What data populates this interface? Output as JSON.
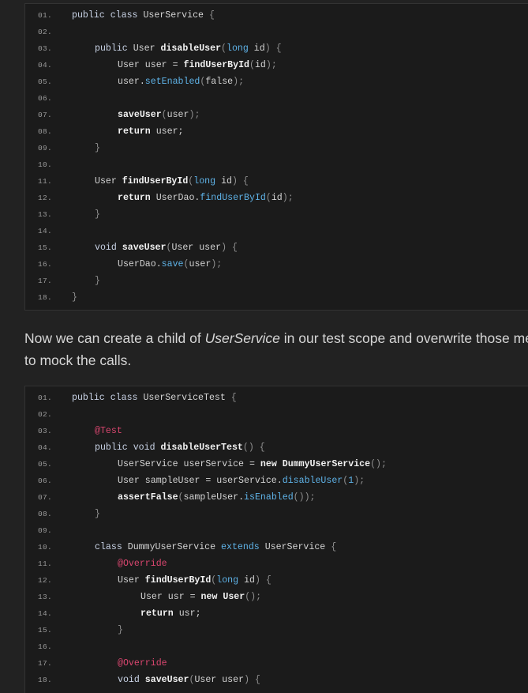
{
  "code_block_1": {
    "lines": [
      {
        "num": "01.",
        "indent": 0,
        "tokens": [
          [
            "kw",
            "public "
          ],
          [
            "kw",
            "class "
          ],
          [
            "plain",
            "UserService "
          ],
          [
            "punct",
            "{"
          ]
        ]
      },
      {
        "num": "02.",
        "indent": 0,
        "tokens": []
      },
      {
        "num": "03.",
        "indent": 1,
        "tokens": [
          [
            "kw",
            "public "
          ],
          [
            "plain",
            "User "
          ],
          [
            "bold",
            "disableUser"
          ],
          [
            "punct",
            "("
          ],
          [
            "call",
            "long "
          ],
          [
            "plain",
            "id"
          ],
          [
            "punct",
            ") {"
          ]
        ]
      },
      {
        "num": "04.",
        "indent": 2,
        "tokens": [
          [
            "plain",
            "User user = "
          ],
          [
            "bold",
            "findUserById"
          ],
          [
            "punct",
            "("
          ],
          [
            "plain",
            "id"
          ],
          [
            "punct",
            ");"
          ]
        ]
      },
      {
        "num": "05.",
        "indent": 2,
        "tokens": [
          [
            "plain",
            "user."
          ],
          [
            "call",
            "setEnabled"
          ],
          [
            "punct",
            "("
          ],
          [
            "plain",
            "false"
          ],
          [
            "punct",
            ");"
          ]
        ]
      },
      {
        "num": "06.",
        "indent": 0,
        "tokens": []
      },
      {
        "num": "07.",
        "indent": 2,
        "tokens": [
          [
            "bold",
            "saveUser"
          ],
          [
            "punct",
            "("
          ],
          [
            "plain",
            "user"
          ],
          [
            "punct",
            ");"
          ]
        ]
      },
      {
        "num": "08.",
        "indent": 2,
        "tokens": [
          [
            "bold",
            "return "
          ],
          [
            "plain",
            "user;"
          ]
        ]
      },
      {
        "num": "09.",
        "indent": 1,
        "tokens": [
          [
            "punct",
            "}"
          ]
        ]
      },
      {
        "num": "10.",
        "indent": 0,
        "tokens": []
      },
      {
        "num": "11.",
        "indent": 1,
        "tokens": [
          [
            "plain",
            "User "
          ],
          [
            "bold",
            "findUserById"
          ],
          [
            "punct",
            "("
          ],
          [
            "call",
            "long "
          ],
          [
            "plain",
            "id"
          ],
          [
            "punct",
            ") {"
          ]
        ]
      },
      {
        "num": "12.",
        "indent": 2,
        "tokens": [
          [
            "bold",
            "return "
          ],
          [
            "plain",
            "UserDao."
          ],
          [
            "call",
            "findUserById"
          ],
          [
            "punct",
            "("
          ],
          [
            "plain",
            "id"
          ],
          [
            "punct",
            ");"
          ]
        ]
      },
      {
        "num": "13.",
        "indent": 1,
        "tokens": [
          [
            "punct",
            "}"
          ]
        ]
      },
      {
        "num": "14.",
        "indent": 0,
        "tokens": []
      },
      {
        "num": "15.",
        "indent": 1,
        "tokens": [
          [
            "kw",
            "void "
          ],
          [
            "bold",
            "saveUser"
          ],
          [
            "punct",
            "("
          ],
          [
            "plain",
            "User user"
          ],
          [
            "punct",
            ") {"
          ]
        ]
      },
      {
        "num": "16.",
        "indent": 2,
        "tokens": [
          [
            "plain",
            "UserDao."
          ],
          [
            "call",
            "save"
          ],
          [
            "punct",
            "("
          ],
          [
            "plain",
            "user"
          ],
          [
            "punct",
            ");"
          ]
        ]
      },
      {
        "num": "17.",
        "indent": 1,
        "tokens": [
          [
            "punct",
            "}"
          ]
        ]
      },
      {
        "num": "18.",
        "indent": 0,
        "tokens": [
          [
            "punct",
            "}"
          ]
        ]
      }
    ]
  },
  "prose": {
    "before": "Now we can create a child of ",
    "emphasis": "UserService",
    "after": " in our test scope and overwrite those methods to mock the calls."
  },
  "code_block_2": {
    "lines": [
      {
        "num": "01.",
        "indent": 0,
        "tokens": [
          [
            "kw",
            "public "
          ],
          [
            "kw",
            "class "
          ],
          [
            "plain",
            "UserServiceTest "
          ],
          [
            "punct",
            "{"
          ]
        ]
      },
      {
        "num": "02.",
        "indent": 0,
        "tokens": []
      },
      {
        "num": "03.",
        "indent": 1,
        "tokens": [
          [
            "anno",
            "@Test"
          ]
        ]
      },
      {
        "num": "04.",
        "indent": 1,
        "tokens": [
          [
            "kw",
            "public "
          ],
          [
            "kw",
            "void "
          ],
          [
            "bold",
            "disableUserTest"
          ],
          [
            "punct",
            "() {"
          ]
        ]
      },
      {
        "num": "05.",
        "indent": 2,
        "tokens": [
          [
            "plain",
            "UserService userService = "
          ],
          [
            "bold",
            "new "
          ],
          [
            "bold",
            "DummyUserService"
          ],
          [
            "punct",
            "();"
          ]
        ]
      },
      {
        "num": "06.",
        "indent": 2,
        "tokens": [
          [
            "plain",
            "User sampleUser = userService."
          ],
          [
            "call",
            "disableUser"
          ],
          [
            "punct",
            "("
          ],
          [
            "call",
            "1"
          ],
          [
            "punct",
            ");"
          ]
        ]
      },
      {
        "num": "07.",
        "indent": 2,
        "tokens": [
          [
            "bold",
            "assertFalse"
          ],
          [
            "punct",
            "("
          ],
          [
            "plain",
            "sampleUser."
          ],
          [
            "call",
            "isEnabled"
          ],
          [
            "punct",
            "());"
          ]
        ]
      },
      {
        "num": "08.",
        "indent": 1,
        "tokens": [
          [
            "punct",
            "}"
          ]
        ]
      },
      {
        "num": "09.",
        "indent": 0,
        "tokens": []
      },
      {
        "num": "10.",
        "indent": 1,
        "tokens": [
          [
            "kw",
            "class "
          ],
          [
            "plain",
            "DummyUserService "
          ],
          [
            "call",
            "extends "
          ],
          [
            "plain",
            "UserService "
          ],
          [
            "punct",
            "{"
          ]
        ]
      },
      {
        "num": "11.",
        "indent": 2,
        "tokens": [
          [
            "anno",
            "@Override"
          ]
        ]
      },
      {
        "num": "12.",
        "indent": 2,
        "tokens": [
          [
            "plain",
            "User "
          ],
          [
            "bold",
            "findUserById"
          ],
          [
            "punct",
            "("
          ],
          [
            "call",
            "long "
          ],
          [
            "plain",
            "id"
          ],
          [
            "punct",
            ") {"
          ]
        ]
      },
      {
        "num": "13.",
        "indent": 3,
        "tokens": [
          [
            "plain",
            "User usr = "
          ],
          [
            "bold",
            "new "
          ],
          [
            "bold",
            "User"
          ],
          [
            "punct",
            "();"
          ]
        ]
      },
      {
        "num": "14.",
        "indent": 3,
        "tokens": [
          [
            "bold",
            "return "
          ],
          [
            "plain",
            "usr;"
          ]
        ]
      },
      {
        "num": "15.",
        "indent": 2,
        "tokens": [
          [
            "punct",
            "}"
          ]
        ]
      },
      {
        "num": "16.",
        "indent": 0,
        "tokens": []
      },
      {
        "num": "17.",
        "indent": 2,
        "tokens": [
          [
            "anno",
            "@Override"
          ]
        ]
      },
      {
        "num": "18.",
        "indent": 2,
        "tokens": [
          [
            "kw",
            "void "
          ],
          [
            "bold",
            "saveUser"
          ],
          [
            "punct",
            "("
          ],
          [
            "plain",
            "User user"
          ],
          [
            "punct",
            ") {"
          ]
        ]
      }
    ]
  }
}
